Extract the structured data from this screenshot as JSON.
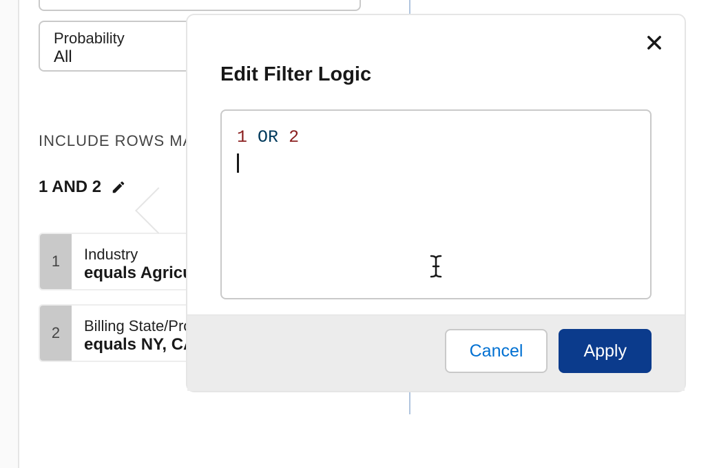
{
  "panel": {
    "probability": {
      "label": "Probability",
      "value": "All"
    },
    "section_label": "INCLUDE ROWS MATCHING",
    "filter_logic_text": "1 AND 2",
    "filters": [
      {
        "num": "1",
        "field": "Industry",
        "cond": "equals Agriculture"
      },
      {
        "num": "2",
        "field": "Billing State/Province",
        "cond": "equals NY, CA"
      }
    ]
  },
  "popover": {
    "title": "Edit Filter Logic",
    "input_value": "1 OR 2",
    "cancel_label": "Cancel",
    "apply_label": "Apply"
  }
}
